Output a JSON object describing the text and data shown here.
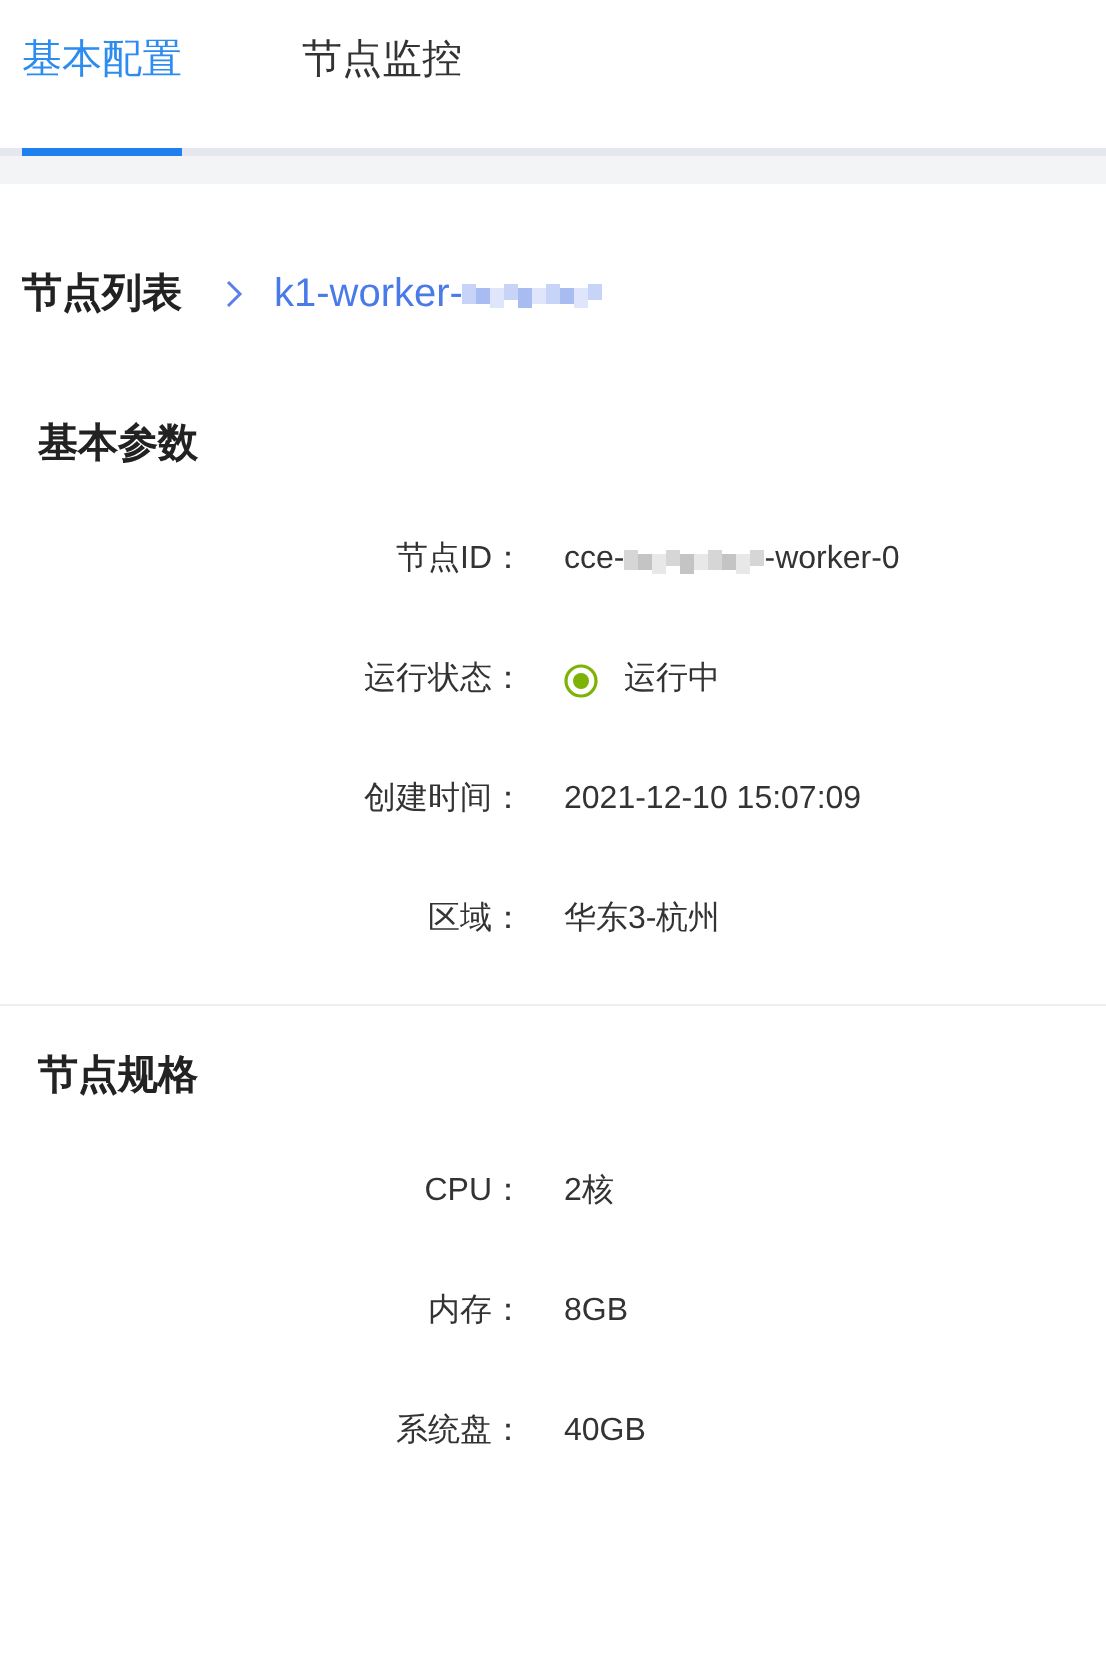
{
  "tabs": [
    {
      "label": "基本配置",
      "selected": true
    },
    {
      "label": "节点监控",
      "selected": false
    }
  ],
  "breadcrumb": {
    "root": "节点列表",
    "current": "k1-worker-",
    "current_redacted": true
  },
  "sections": [
    {
      "title": "基本参数",
      "rows": [
        {
          "kind": "text",
          "label": "节点ID：",
          "value": "cce-",
          "suffix": "-worker-0",
          "redacted": true
        },
        {
          "kind": "status",
          "label": "运行状态：",
          "value": "运行中",
          "color": "#7cb305"
        },
        {
          "kind": "text",
          "label": "创建时间：",
          "value": "2021-12-10 15:07:09"
        },
        {
          "kind": "text",
          "label": "区域：",
          "value": "华东3-杭州"
        }
      ]
    },
    {
      "title": "节点规格",
      "rows": [
        {
          "kind": "text",
          "label": "CPU：",
          "value": "2核"
        },
        {
          "kind": "text",
          "label": "内存：",
          "value": "8GB"
        },
        {
          "kind": "text",
          "label": "系统盘：",
          "value": "40GB"
        }
      ]
    }
  ]
}
